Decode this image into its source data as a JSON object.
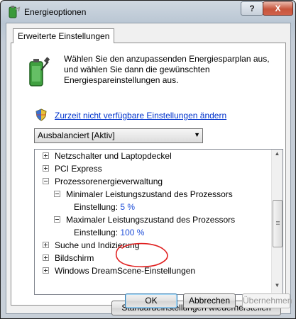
{
  "window": {
    "title": "Energieoptionen",
    "help_label": "?",
    "close_label": "X"
  },
  "tab": {
    "label": "Erweiterte Einstellungen"
  },
  "intro_text": "Wählen Sie den anzupassenden Energiesparplan aus, und wählen Sie dann die gewünschten Energiespareinstellungen aus.",
  "admin_link": "Zurzeit nicht verfügbare Einstellungen ändern",
  "plan_select": {
    "value": "Ausbalanciert [Aktiv]"
  },
  "tree": {
    "items": [
      {
        "label": "Netzschalter und Laptopdeckel"
      },
      {
        "label": "PCI Express"
      },
      {
        "label": "Prozessorenergieverwaltung"
      },
      {
        "label": "Minimaler Leistungszustand des Prozessors"
      },
      {
        "label": "Einstellung:",
        "value": "5 %"
      },
      {
        "label": "Maximaler Leistungszustand des Prozessors"
      },
      {
        "label": "Einstellung:",
        "value": "100 %"
      },
      {
        "label": "Suche und Indizierung"
      },
      {
        "label": "Bildschirm"
      },
      {
        "label": "Windows DreamScene-Einstellungen"
      }
    ]
  },
  "buttons": {
    "restore": "Standardeinstellungen wiederherstellen",
    "ok": "OK",
    "cancel": "Abbrechen",
    "apply": "Übernehmen"
  },
  "colors": {
    "link": "#0033cc",
    "setting_value": "#1f4fd8",
    "annotation": "#e02020"
  }
}
